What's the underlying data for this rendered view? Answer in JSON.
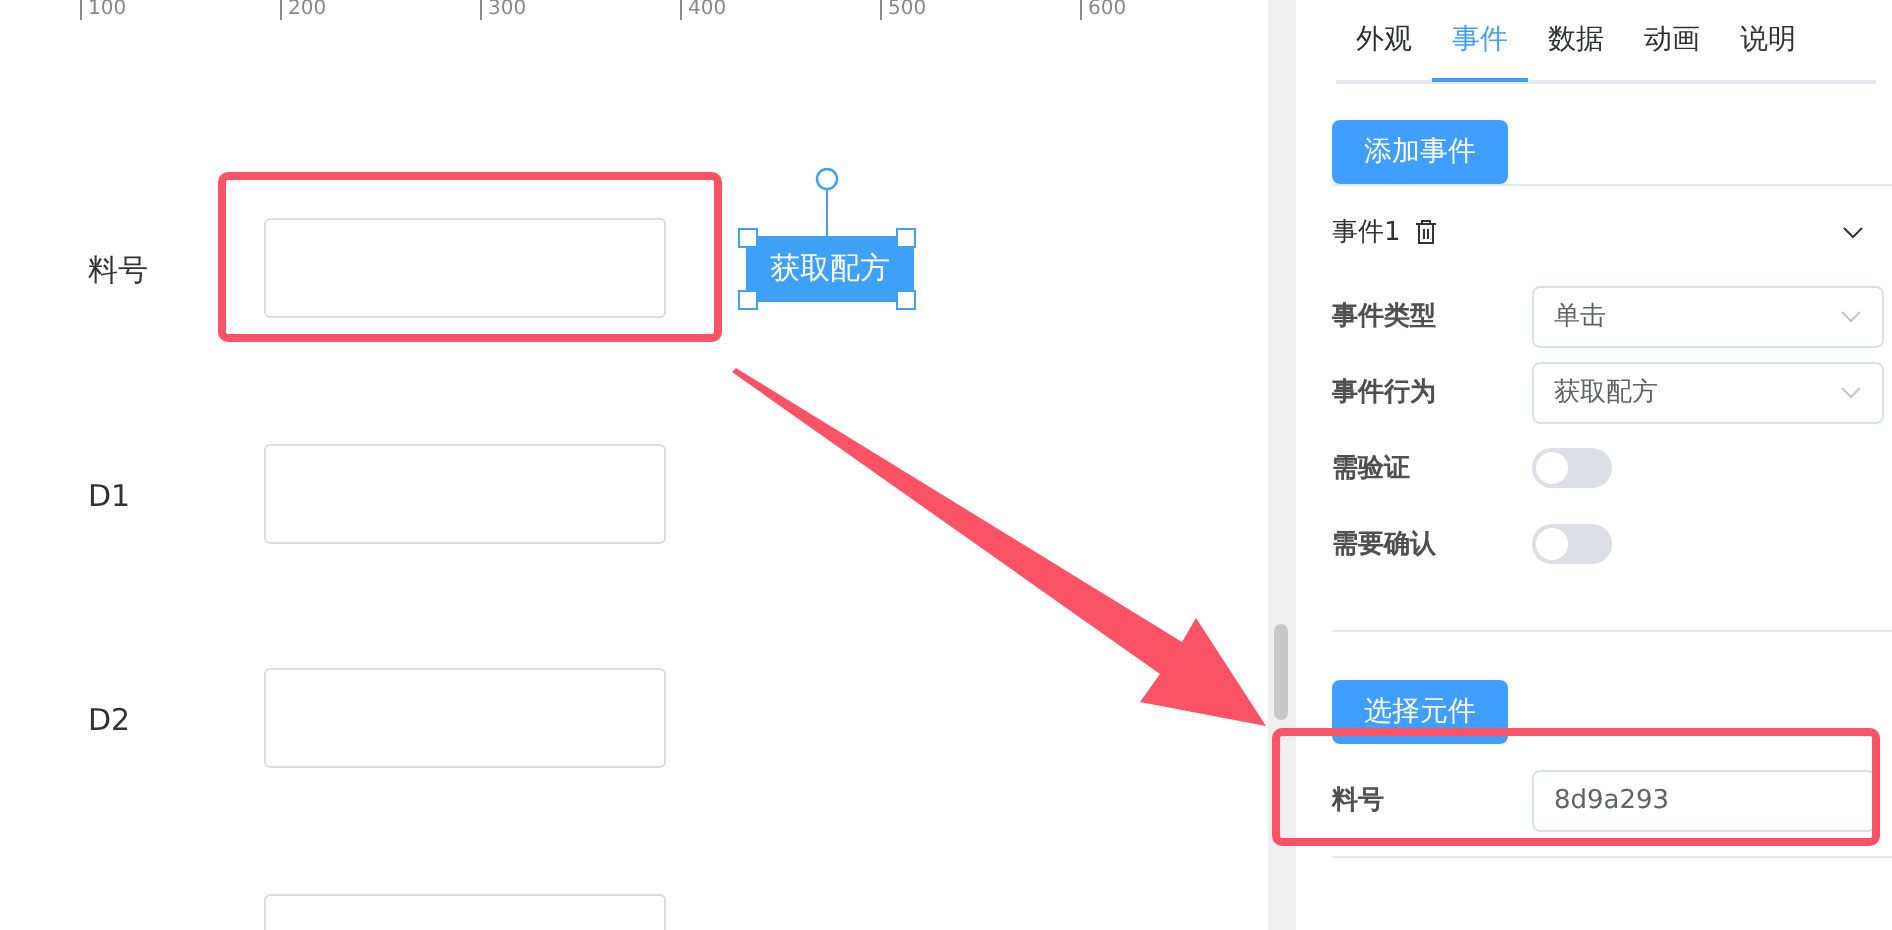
{
  "ruler": {
    "ticks": [
      "100",
      "200",
      "300",
      "400",
      "500",
      "600"
    ]
  },
  "canvas": {
    "fields": [
      {
        "kind": "input",
        "label": "料号"
      },
      {
        "kind": "input",
        "label": "D1"
      },
      {
        "kind": "input",
        "label": "D2"
      },
      {
        "kind": "input"
      }
    ],
    "button": {
      "label": "获取配方",
      "selected": true
    }
  },
  "panel": {
    "tabs": [
      {
        "label": "外观",
        "selected": false
      },
      {
        "label": "事件",
        "selected": true
      },
      {
        "label": "数据",
        "selected": false
      },
      {
        "label": "动画",
        "selected": false
      },
      {
        "label": "说明",
        "selected": false
      }
    ],
    "add_button": "添加事件",
    "event": {
      "title": "事件1",
      "expanded": true,
      "rows": [
        {
          "kind": "select",
          "label": "事件类型",
          "value": "单击"
        },
        {
          "kind": "select",
          "label": "事件行为",
          "value": "获取配方"
        },
        {
          "kind": "switch",
          "label": "需验证",
          "on": false
        },
        {
          "kind": "switch",
          "label": "需要确认",
          "on": false
        }
      ]
    },
    "select_button": "选择元件",
    "binding": {
      "label": "料号",
      "value": "8d9a293"
    }
  }
}
